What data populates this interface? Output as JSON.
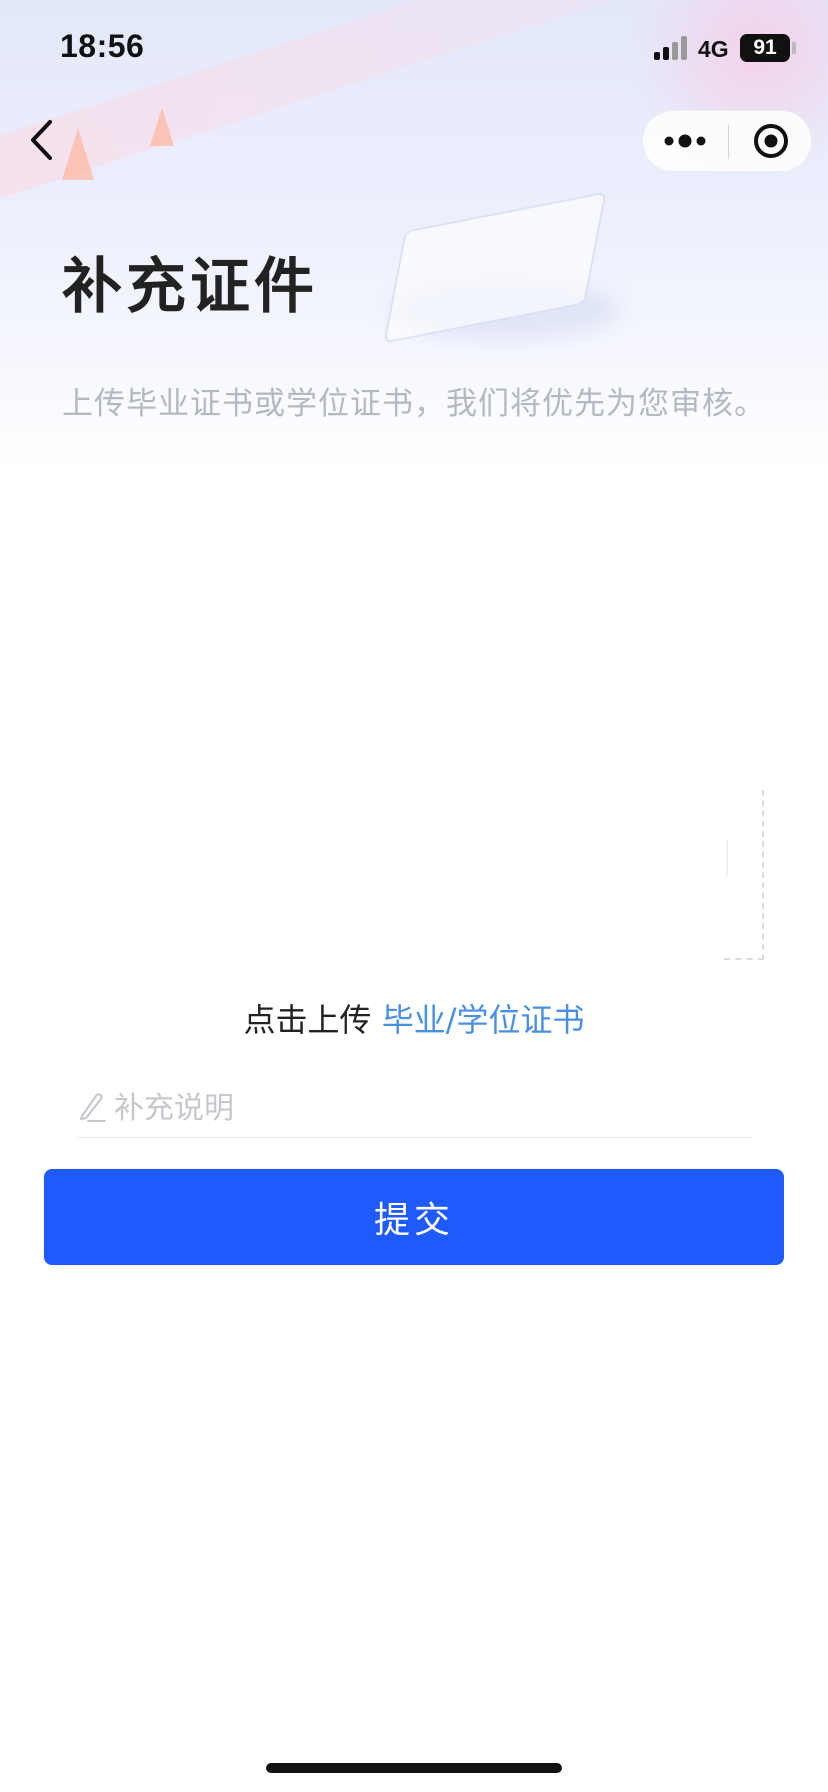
{
  "status_bar": {
    "time": "18:56",
    "network": "4G",
    "battery": "91"
  },
  "nav": {
    "back_icon": "chevron-left-icon",
    "more_icon": "more-dots-icon",
    "target_icon": "target-icon"
  },
  "header": {
    "title": "补充证件",
    "subtitle": "上传毕业证书或学位证书，我们将优先为您审核。"
  },
  "upload": {
    "caption_lead": "点击上传",
    "caption_link": "毕业/学位证书"
  },
  "note": {
    "placeholder": "补充说明",
    "value": "",
    "icon": "pen-icon"
  },
  "submit": {
    "label": "提交"
  },
  "colors": {
    "accent": "#1f5afd",
    "link": "#4a90e2",
    "title": "#222222",
    "subtitle": "#b4b8c0",
    "placeholder": "#c4c7cc"
  }
}
